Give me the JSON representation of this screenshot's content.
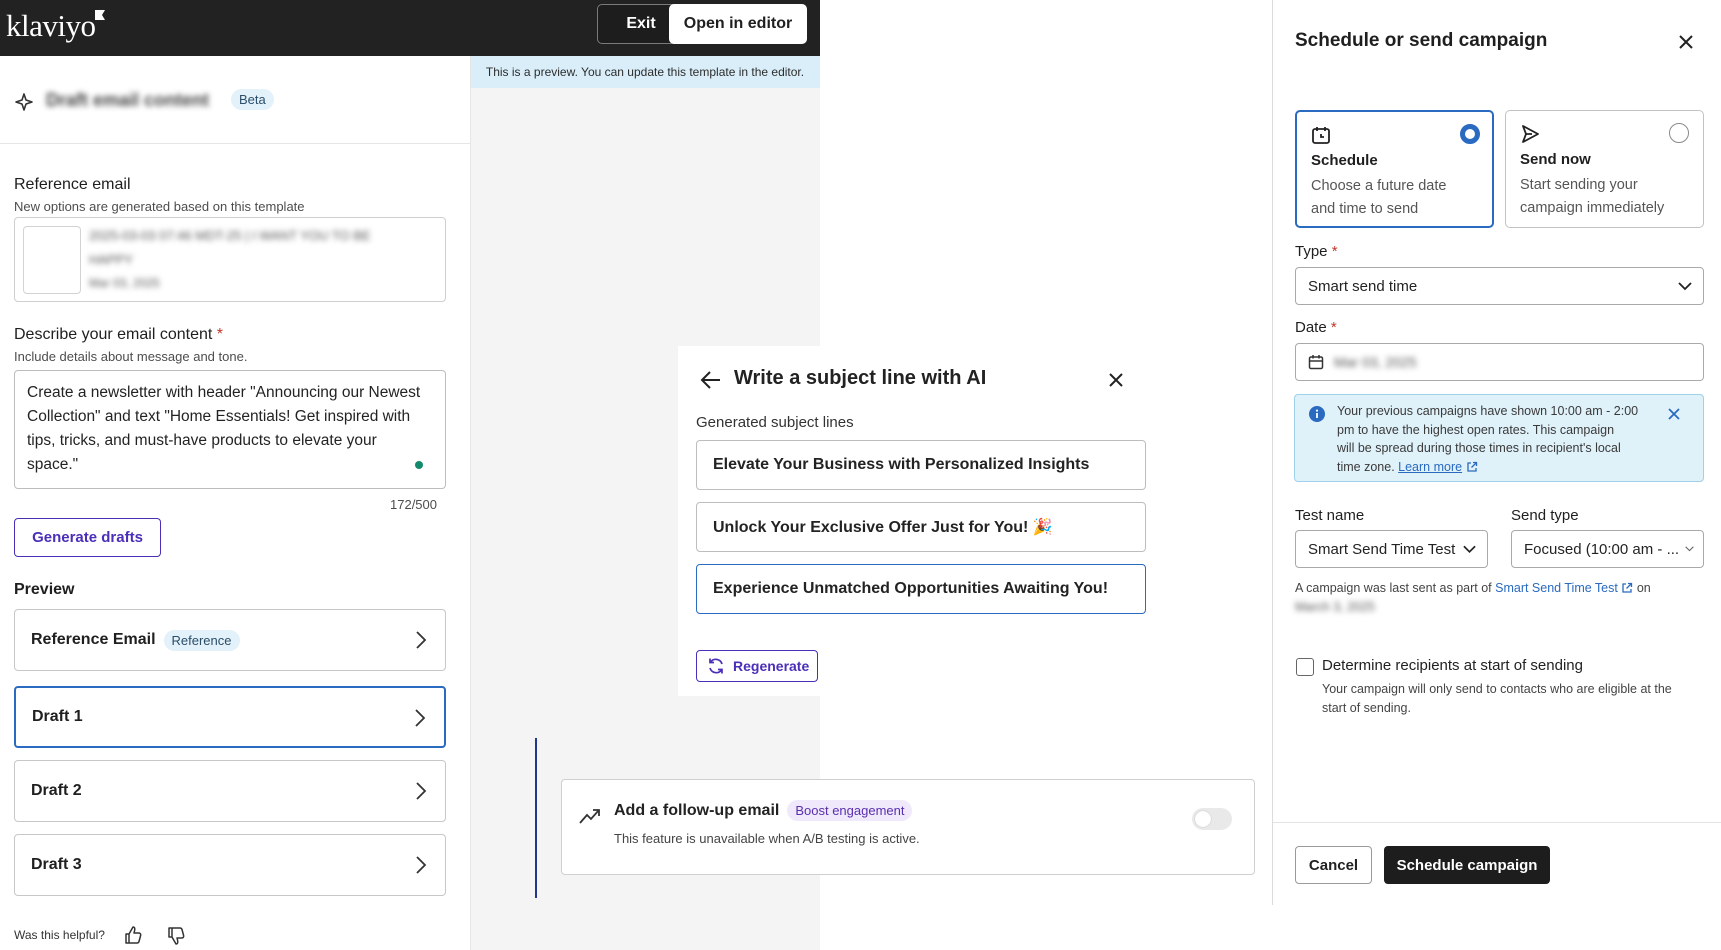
{
  "header": {
    "logo_text": "klaviyo",
    "exit_label": "Exit",
    "open_editor_label": "Open in editor"
  },
  "preview_banner": "This is a preview. You can update this template in the editor.",
  "draft_panel": {
    "title": "Draft email content",
    "beta_badge": "Beta",
    "reference_label": "Reference email",
    "reference_sub": "New options are generated based on this template",
    "reference_email_name_line1": "2025-03-03 07:46 MDT-25 | I WANT YOU TO BE",
    "reference_email_name_line2": "HAPPY",
    "reference_email_date": "Mar 03, 2025",
    "describe_label": "Describe your email content",
    "required_mark": "*",
    "describe_sub": "Include details about message and tone.",
    "describe_value": "Create a newsletter with header \"Announcing our Newest Collection\" and text \"Home Essentials! Get inspired with tips, tricks, and must-have products to elevate your space.\"",
    "char_count": "172/500",
    "generate_label": "Generate drafts",
    "preview_label": "Preview",
    "items": [
      {
        "label": "Reference Email",
        "badge": "Reference"
      },
      {
        "label": "Draft 1"
      },
      {
        "label": "Draft 2"
      },
      {
        "label": "Draft 3"
      }
    ],
    "helpful_label": "Was this helpful?"
  },
  "subject_modal": {
    "title": "Write a subject line with AI",
    "generated_label": "Generated subject lines",
    "options": [
      "Elevate Your Business with Personalized Insights",
      "Unlock Your Exclusive Offer Just for You! 🎉",
      "Experience Unmatched Opportunities Awaiting You!"
    ],
    "regenerate_label": "Regenerate"
  },
  "followup": {
    "title": "Add a follow-up email",
    "badge": "Boost engagement",
    "desc": "This feature is unavailable when A/B testing is active."
  },
  "schedule_panel": {
    "title": "Schedule or send campaign",
    "schedule_title": "Schedule",
    "schedule_desc_line1": "Choose a future date",
    "schedule_desc_line2": "and time to send",
    "send_now_title": "Send now",
    "send_now_desc_line1": "Start sending your",
    "send_now_desc_line2": "campaign immediately",
    "type_label": "Type",
    "required_mark": "*",
    "type_value": "Smart send time",
    "date_label": "Date",
    "date_value": "Mar 03, 2025",
    "info_line1": "Your previous campaigns have shown 10:00 am - 2:00",
    "info_line2": "pm to have the highest open rates. This campaign",
    "info_line3": "will be spread during those times in recipient's local",
    "info_line4": "time zone.",
    "learn_more": "Learn more",
    "test_name_label": "Test name",
    "test_name_value": "Smart Send Time Test",
    "send_type_label": "Send type",
    "send_type_value": "Focused (10:00 am - ...",
    "last_sent_prefix": "A campaign was last sent as part of",
    "last_sent_link": "Smart Send Time Test",
    "last_sent_on": "on",
    "last_sent_date": "March 3, 2025",
    "determine_label": "Determine recipients at start of sending",
    "determine_desc_line1": "Your campaign will only send to contacts who are eligible at the",
    "determine_desc_line2": "start of sending.",
    "cancel_label": "Cancel",
    "schedule_btn_label": "Schedule campaign"
  },
  "colors": {
    "accent_purple": "#4b2fb8",
    "selected_border": "#2a6ac0",
    "topbar": "#222222",
    "info_bg": "#dff1f9"
  }
}
